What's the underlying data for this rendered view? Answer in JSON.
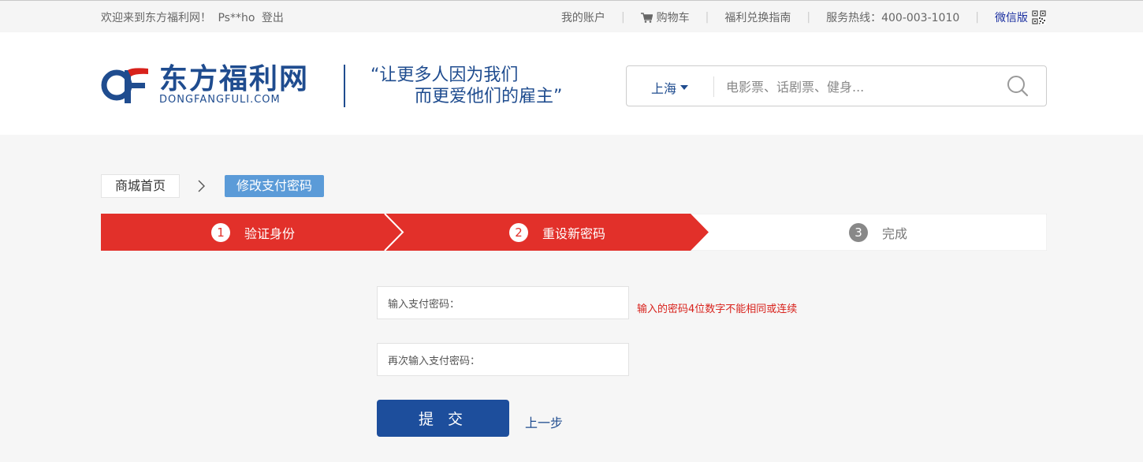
{
  "topbar": {
    "welcome": "欢迎来到东方福利网！",
    "username": "Ps**ho",
    "logout": "登出",
    "my_account": "我的账户",
    "cart": "购物车",
    "guide": "福利兑换指南",
    "hotline": "服务热线：400-003-1010",
    "wechat": "微信版"
  },
  "logo": {
    "cn": "东方福利网",
    "en": "DONGFANGFULI.COM"
  },
  "slogan": {
    "line1": "“让更多人因为我们",
    "line2": "而更爱他们的雇主”"
  },
  "search": {
    "city": "上海",
    "placeholder": "电影票、话剧票、健身..."
  },
  "breadcrumb": {
    "home": "商城首页",
    "current": "修改支付密码"
  },
  "steps": [
    {
      "num": "1",
      "label": "验证身份",
      "state": "done"
    },
    {
      "num": "2",
      "label": "重设新密码",
      "state": "active"
    },
    {
      "num": "3",
      "label": "完成",
      "state": "todo"
    }
  ],
  "form": {
    "pwd_label": "输入支付密码：",
    "pwd_confirm_label": "再次输入支付密码：",
    "hint": "输入的密码4位数字不能相同或连续",
    "submit": "提 交",
    "back": "上一步"
  },
  "colors": {
    "brand_blue": "#1f4c8f",
    "step_red": "#e2302a",
    "button_blue": "#1d4e9c",
    "crumb_blue": "#5b9bd8",
    "hint_red": "#d8221c"
  }
}
